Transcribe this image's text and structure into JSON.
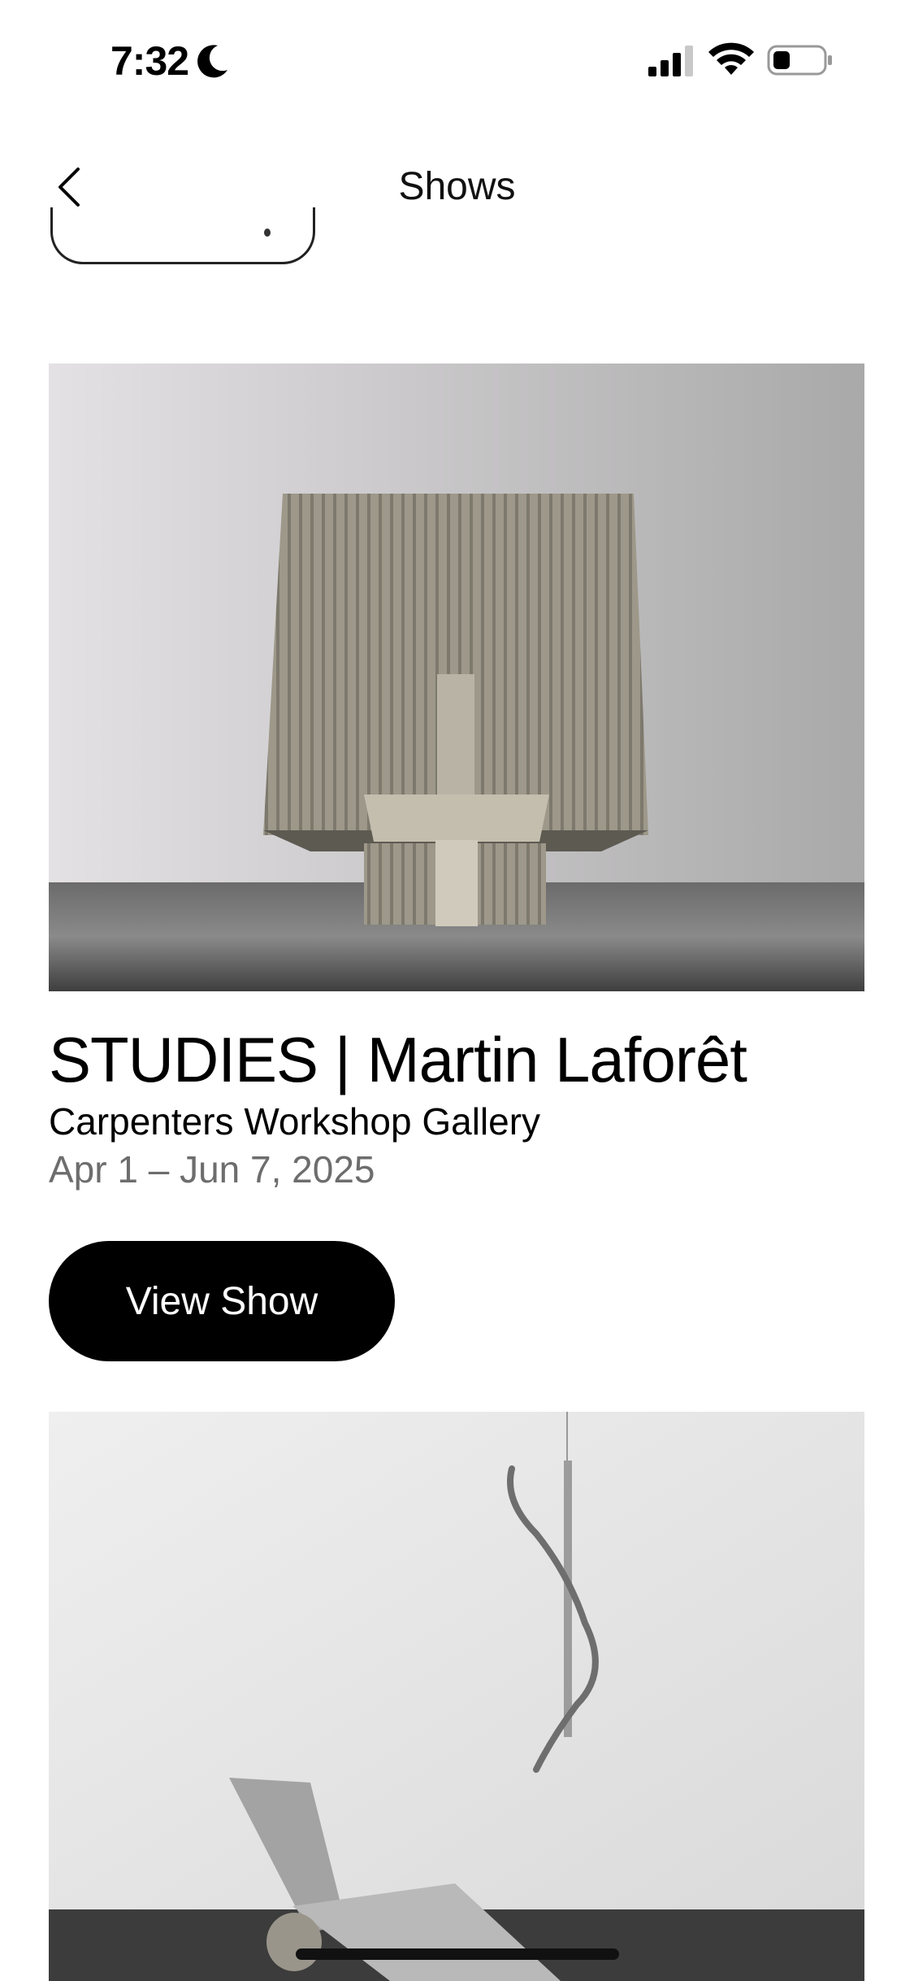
{
  "status_bar": {
    "time": "7:32",
    "icons": [
      "moon-icon",
      "signal-icon",
      "wifi-icon",
      "battery-icon"
    ]
  },
  "nav": {
    "title": "Shows",
    "back_icon": "chevron-left-icon"
  },
  "shows": [
    {
      "title": "STUDIES | Martin Laforêt",
      "gallery": "Carpenters Workshop Gallery",
      "dates": "Apr 1 – Jun 7, 2025",
      "button_label": "View Show"
    }
  ],
  "colors": {
    "button_bg": "#000000",
    "button_text": "#ffffff",
    "dates_text": "#6d6d6d"
  }
}
